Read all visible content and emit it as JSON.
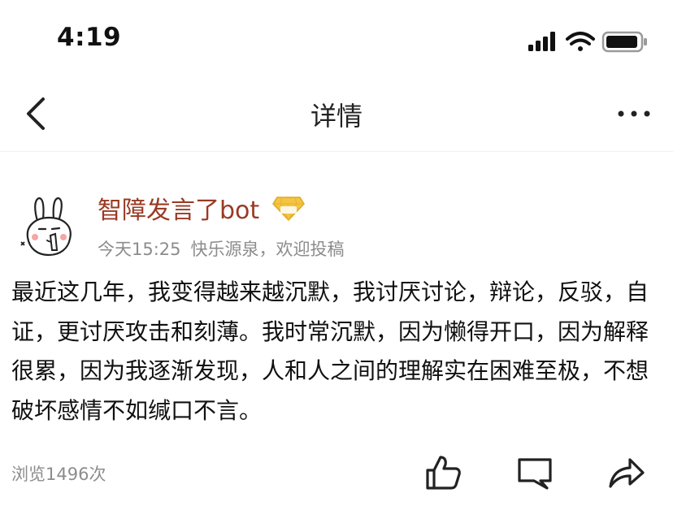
{
  "status_bar": {
    "time": "4:19",
    "icons": [
      "signal-icon",
      "wifi-icon",
      "battery-icon"
    ]
  },
  "nav": {
    "title": "详情",
    "back_icon": "chevron-left-icon",
    "more_icon": "more-icon"
  },
  "post": {
    "author": "智障发言了bot",
    "level_badge_icon": "diamond-level-icon",
    "time": "今天15:25",
    "source": "快乐源泉，欢迎投稿",
    "body": "最近这几年，我变得越来越沉默，我讨厌讨论，辩论，反驳，自证，更讨厌攻击和刻薄。我时常沉默，因为懒得开口，因为解释很累，因为我逐渐发现，人和人之间的理解实在困难至极，不想破坏感情不如缄口不言。"
  },
  "footer": {
    "views": "浏览1496次",
    "actions": [
      "like-icon",
      "comment-icon",
      "share-icon"
    ]
  },
  "colors": {
    "author": "#9a3a24",
    "meta": "#8c8c8c",
    "text": "#111111",
    "badge": "#f4c542"
  }
}
